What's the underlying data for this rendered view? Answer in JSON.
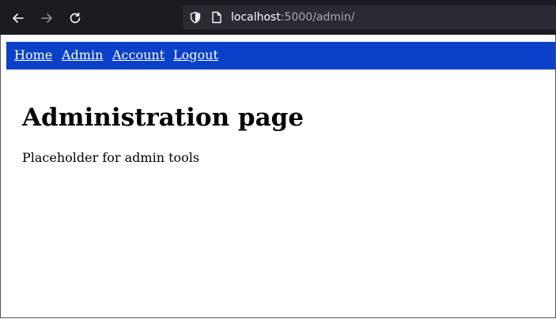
{
  "browser": {
    "url_host": "localhost",
    "url_path": ":5000/admin/",
    "icons": {
      "back": "arrow-left-icon",
      "forward": "arrow-right-icon",
      "reload": "reload-icon",
      "security": "shield-icon",
      "page": "page-icon"
    }
  },
  "navbar": {
    "color": "#0b41c8",
    "links": [
      {
        "label": "Home"
      },
      {
        "label": "Admin"
      },
      {
        "label": "Account"
      },
      {
        "label": "Logout"
      }
    ]
  },
  "main": {
    "title": "Administration page",
    "body": "Placeholder for admin tools"
  }
}
